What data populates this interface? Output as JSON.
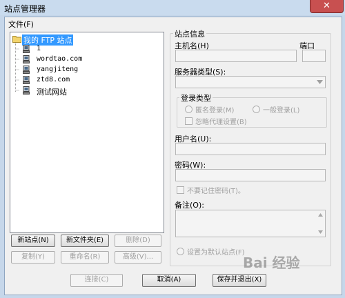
{
  "window": {
    "title": "站点管理器",
    "close_glyph": "✕"
  },
  "menu": {
    "file": "文件(F)"
  },
  "tree": {
    "root": "我的 FTP 站点",
    "items": [
      "1",
      "wordtao.com",
      "yangjiteng",
      "ztd8.com",
      "测试网站"
    ]
  },
  "site_info": {
    "group_title": "站点信息",
    "host_label": "主机名(H)",
    "port_label": "端口",
    "server_type_label": "服务器类型(S):",
    "login_type_title": "登录类型",
    "anonymous_label": "匿名登录(M)",
    "normal_label": "一般登录(L)",
    "ignore_proxy_label": "忽略代理设置(B)",
    "user_label": "用户名(U):",
    "password_label": "密码(W):",
    "no_remember_label": "不要记住密码(T)。",
    "notes_label": "备注(O):",
    "default_site_label": "设置为默认站点(F)"
  },
  "left_buttons": {
    "new_site": "新站点(N)",
    "new_folder": "新文件夹(E)",
    "delete": "删除(D)",
    "copy": "复制(Y)",
    "rename": "重命名(R)",
    "advanced": "高级(V)..."
  },
  "bottom_buttons": {
    "connect": "连接(C)",
    "cancel": "取消(A)",
    "save_exit": "保存并退出(X)"
  },
  "watermark": "Bai 经验"
}
